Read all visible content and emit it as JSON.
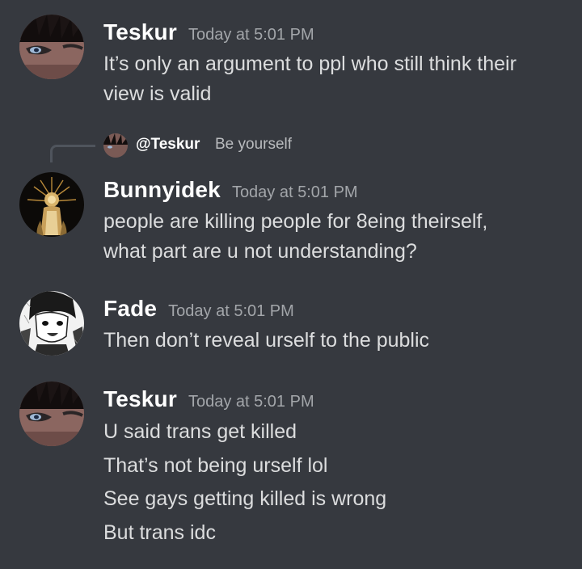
{
  "messages": [
    {
      "username": "Teskur",
      "timestamp": "Today at 5:01 PM",
      "lines": [
        "It’s only an argument to ppl who still think their",
        "view is valid"
      ]
    },
    {
      "reply": {
        "mention": "@Teskur",
        "text": "Be yourself"
      },
      "username": "Bunnyidek",
      "timestamp": "Today at 5:01 PM",
      "lines": [
        "people are killing people for 8eing theirself,",
        "what part are u not understanding?"
      ]
    },
    {
      "username": "Fade",
      "timestamp": "Today at 5:01 PM",
      "lines": [
        "Then don’t reveal urself to the public"
      ]
    },
    {
      "username": "Teskur",
      "timestamp": "Today at 5:01 PM",
      "lines": [
        "U said trans get killed",
        "That’s not being urself lol",
        "See gays getting killed is wrong",
        "But trans idc"
      ]
    }
  ],
  "icons": {
    "teskur_avatar": "avatar-icon",
    "bunnyidek_avatar": "avatar-icon",
    "fade_avatar": "avatar-icon",
    "reply_spine": "reply-line-icon"
  },
  "colors": {
    "background": "#36393f",
    "username": "#ffffff",
    "timestamp": "#a3a6aa",
    "message_text": "#dcddde",
    "reply_text": "#b9bbbe"
  }
}
